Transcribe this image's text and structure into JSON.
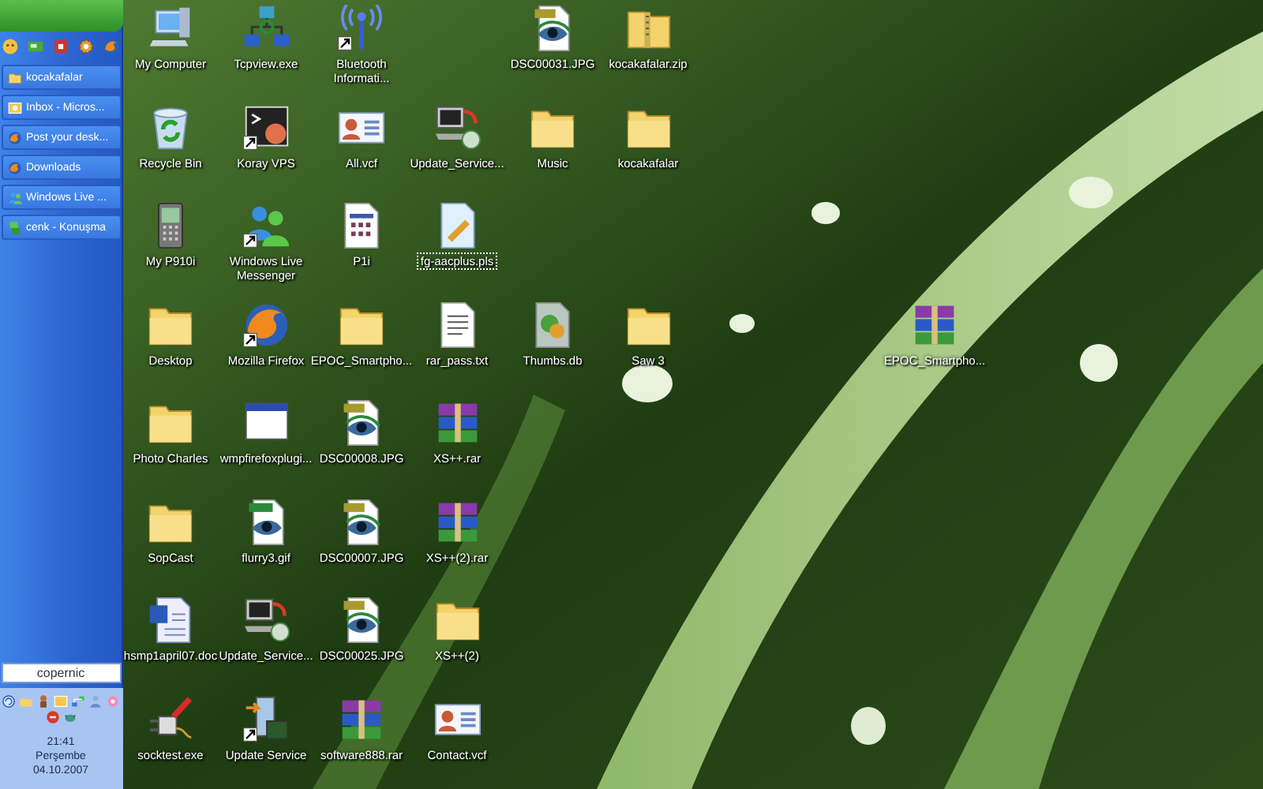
{
  "taskbar": {
    "tasks": [
      {
        "label": "kocakafalar",
        "kind": "folder",
        "selected": false
      },
      {
        "label": "Inbox - Micros...",
        "kind": "mail",
        "selected": false
      },
      {
        "label": "Post your desk...",
        "kind": "firefox",
        "selected": false
      },
      {
        "label": "Downloads",
        "kind": "firefox",
        "selected": false
      },
      {
        "label": "Windows Live ...",
        "kind": "messenger",
        "selected": false
      },
      {
        "label": "cenk - Konuşma",
        "kind": "chat",
        "selected": false
      }
    ],
    "search": {
      "placeholder": "copernic"
    },
    "clock": {
      "time": "21:41",
      "day": "Perşembe",
      "date": "04.10.2007"
    }
  },
  "desktop_icons": [
    {
      "label": "My Computer",
      "kind": "computer",
      "shortcut": false,
      "selected": false
    },
    {
      "label": "Tcpview.exe",
      "kind": "network",
      "shortcut": false,
      "selected": false
    },
    {
      "label": "Bluetooth Informati...",
      "kind": "bluetooth",
      "shortcut": true,
      "selected": false
    },
    {
      "label": "DSC00031.JPG",
      "kind": "jpg",
      "shortcut": false,
      "selected": false
    },
    {
      "label": "kocakafalar.zip",
      "kind": "zip",
      "shortcut": false,
      "selected": false
    },
    {
      "label": "Recycle Bin",
      "kind": "recycle",
      "shortcut": false,
      "selected": false
    },
    {
      "label": "Koray VPS",
      "kind": "terminal",
      "shortcut": true,
      "selected": false
    },
    {
      "label": "All.vcf",
      "kind": "vcard",
      "shortcut": false,
      "selected": false
    },
    {
      "label": "Update_Service...",
      "kind": "update",
      "shortcut": false,
      "selected": false
    },
    {
      "label": "Music",
      "kind": "folder",
      "shortcut": false,
      "selected": false
    },
    {
      "label": "kocakafalar",
      "kind": "folder",
      "shortcut": false,
      "selected": false
    },
    {
      "label": "My P910i",
      "kind": "phone",
      "shortcut": false,
      "selected": false
    },
    {
      "label": "Windows Live Messenger",
      "kind": "messenger",
      "shortcut": true,
      "selected": false
    },
    {
      "label": "P1i",
      "kind": "grid",
      "shortcut": false,
      "selected": false
    },
    {
      "label": "fg-aacplus.pls",
      "kind": "playlist",
      "shortcut": false,
      "selected": true
    },
    {
      "label": "Desktop",
      "kind": "folder",
      "shortcut": false,
      "selected": false
    },
    {
      "label": "Mozilla Firefox",
      "kind": "firefox",
      "shortcut": true,
      "selected": false
    },
    {
      "label": "EPOC_Smartpho...",
      "kind": "folder",
      "shortcut": false,
      "selected": false
    },
    {
      "label": "rar_pass.txt",
      "kind": "text",
      "shortcut": false,
      "selected": false
    },
    {
      "label": "Thumbs.db",
      "kind": "thumbs",
      "shortcut": false,
      "selected": false
    },
    {
      "label": "Saw 3",
      "kind": "folder",
      "shortcut": false,
      "selected": false
    },
    {
      "label": "EPOC_Smartpho...",
      "kind": "rar",
      "shortcut": false,
      "selected": false
    },
    {
      "label": "Photo Charles",
      "kind": "folder",
      "shortcut": false,
      "selected": false
    },
    {
      "label": "wmpfirefoxplugi...",
      "kind": "window",
      "shortcut": false,
      "selected": false
    },
    {
      "label": "DSC00008.JPG",
      "kind": "jpg",
      "shortcut": false,
      "selected": false
    },
    {
      "label": "XS++.rar",
      "kind": "rar",
      "shortcut": false,
      "selected": false
    },
    {
      "label": "SopCast",
      "kind": "folder",
      "shortcut": false,
      "selected": false
    },
    {
      "label": "flurry3.gif",
      "kind": "gif",
      "shortcut": false,
      "selected": false
    },
    {
      "label": "DSC00007.JPG",
      "kind": "jpg",
      "shortcut": false,
      "selected": false
    },
    {
      "label": "XS++(2).rar",
      "kind": "rar",
      "shortcut": false,
      "selected": false
    },
    {
      "label": "hsmp1april07.doc",
      "kind": "doc",
      "shortcut": false,
      "selected": false
    },
    {
      "label": "Update_Service...",
      "kind": "update",
      "shortcut": false,
      "selected": false
    },
    {
      "label": "DSC00025.JPG",
      "kind": "jpg",
      "shortcut": false,
      "selected": false
    },
    {
      "label": "XS++(2)",
      "kind": "folder",
      "shortcut": false,
      "selected": false
    },
    {
      "label": "socktest.exe",
      "kind": "plug",
      "shortcut": false,
      "selected": false
    },
    {
      "label": "Update Service",
      "kind": "device",
      "shortcut": true,
      "selected": false
    },
    {
      "label": "software888.rar",
      "kind": "rar",
      "shortcut": false,
      "selected": false
    },
    {
      "label": "Contact.vcf",
      "kind": "vcard",
      "shortcut": false,
      "selected": false
    }
  ]
}
